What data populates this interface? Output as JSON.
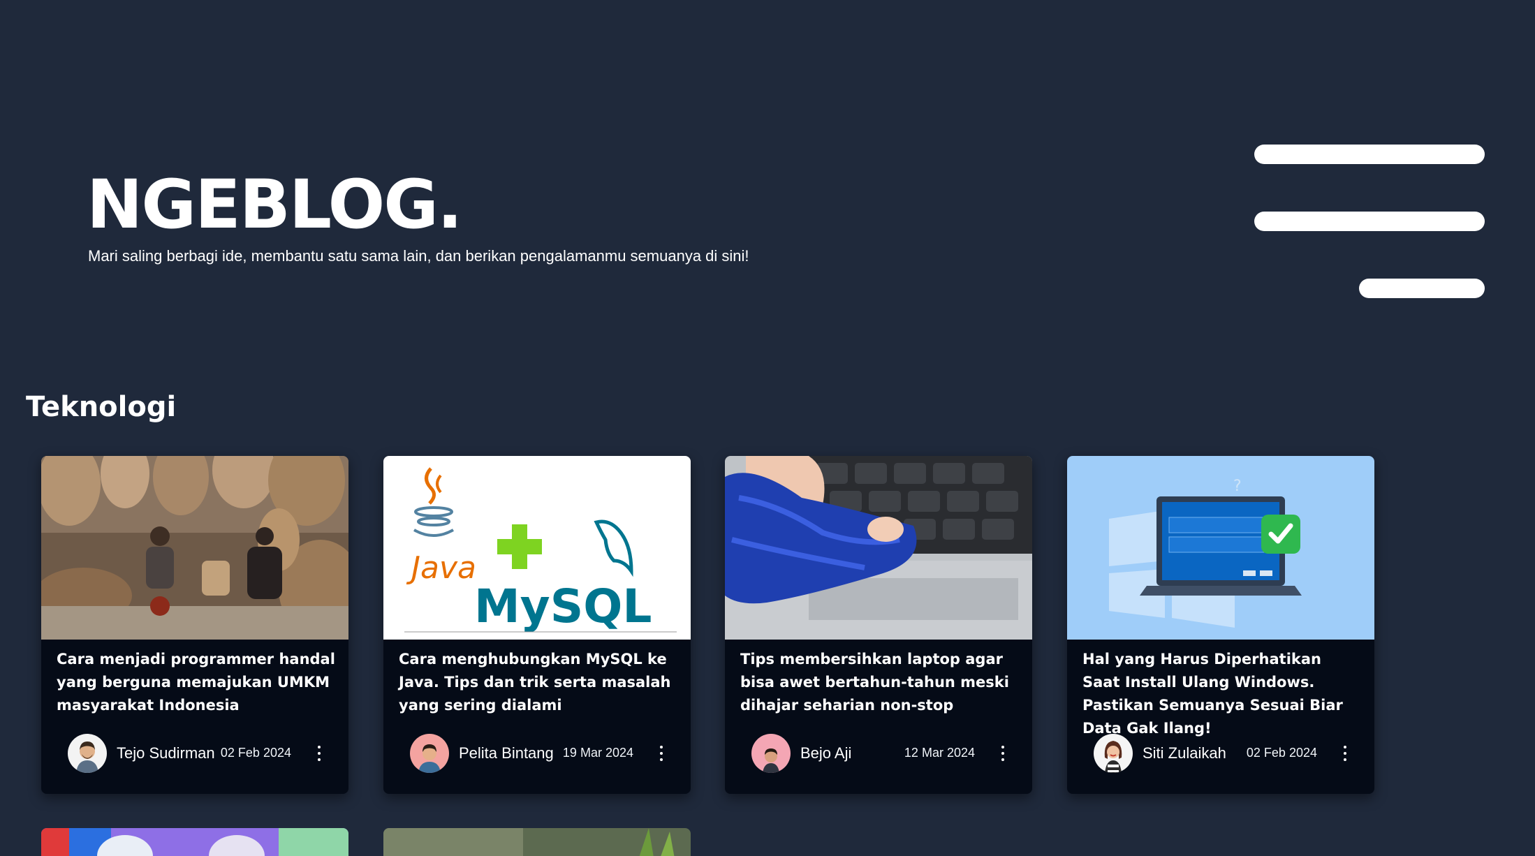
{
  "site": {
    "brand": "NGEBLOG.",
    "tagline": "Mari saling berbagi ide, membantu satu sama lain, dan berikan pengalamanmu semuanya di sini!"
  },
  "colors": {
    "background": "#1f293b",
    "card_background": "#050b17",
    "text": "#ffffff"
  },
  "menu": {
    "icon": "hamburger-menu-icon"
  },
  "section": {
    "title": "Teknologi"
  },
  "posts": [
    {
      "title": "Cara menjadi programmer handal yang berguna memajukan UMKM masyarakat Indonesia",
      "author": "Tejo Sudirman",
      "date": "02 Feb 2024",
      "thumbnail": "craft-market-photo"
    },
    {
      "title": "Cara menghubungkan MySQL ke Java. Tips dan trik serta masalah yang sering dialami",
      "author": "Pelita Bintang",
      "date": "19 Mar 2024",
      "thumbnail": "java-mysql-logo",
      "thumbnail_text": {
        "java": "Java",
        "mysql": "MySQL"
      }
    },
    {
      "title": "Tips membersihkan laptop agar bisa awet bertahun-tahun meski dihajar seharian non-stop",
      "author": "Bejo Aji",
      "date": "12 Mar 2024",
      "thumbnail": "laptop-cleaning-photo"
    },
    {
      "title": "Hal yang Harus Diperhatikan Saat Install Ulang Windows. Pastikan Semuanya Sesuai Biar Data Gak Ilang!",
      "author": "Siti Zulaikah",
      "date": "02 Feb 2024",
      "thumbnail": "windows-install-illustration"
    }
  ]
}
